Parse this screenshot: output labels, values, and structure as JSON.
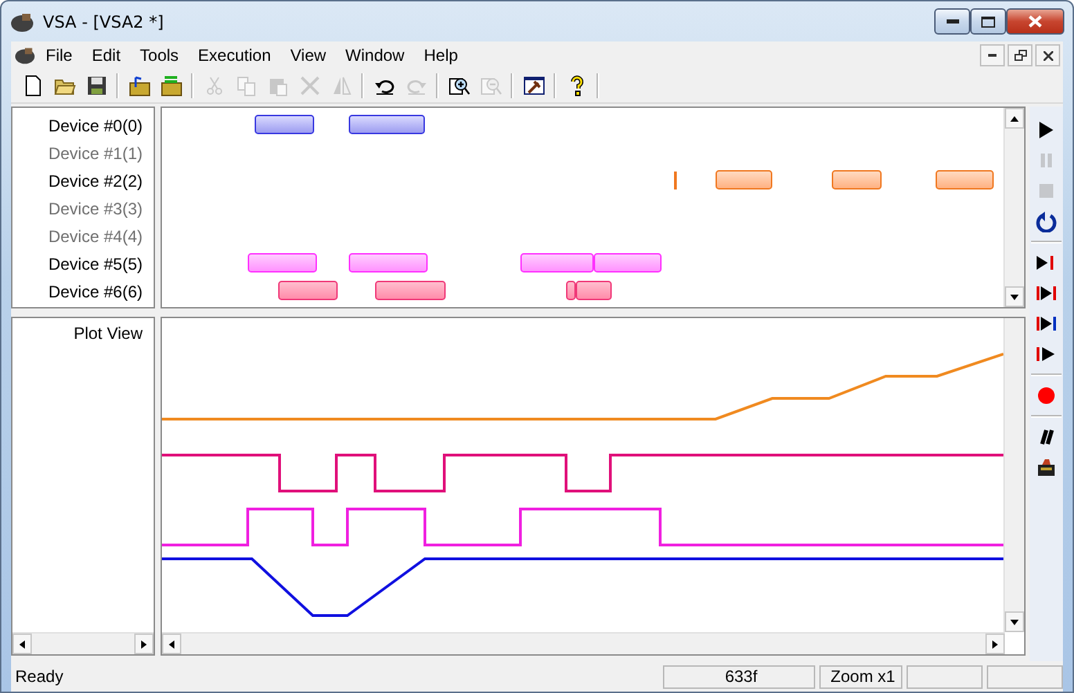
{
  "window": {
    "title": "VSA - [VSA2 *]"
  },
  "menu": [
    "File",
    "Edit",
    "Tools",
    "Execution",
    "View",
    "Window",
    "Help"
  ],
  "toolbar": [
    [
      {
        "disabled": false
      },
      {
        "disabled": false
      },
      {
        "disabled": false
      }
    ],
    [
      {
        "disabled": false
      },
      {
        "disabled": false
      }
    ],
    [
      {
        "disabled": true
      },
      {
        "disabled": true
      },
      {
        "disabled": true
      },
      {
        "disabled": true
      },
      {
        "disabled": true
      }
    ],
    [
      {
        "disabled": false
      },
      {
        "disabled": true
      }
    ],
    [
      {
        "disabled": false
      },
      {
        "disabled": true
      }
    ],
    [
      {
        "disabled": false
      }
    ],
    [
      {
        "disabled": false
      }
    ]
  ],
  "devices": [
    {
      "name": "Device #0(0)",
      "enabled": true
    },
    {
      "name": "Device #1(1)",
      "enabled": false
    },
    {
      "name": "Device #2(2)",
      "enabled": true
    },
    {
      "name": "Device #3(3)",
      "enabled": false
    },
    {
      "name": "Device #4(4)",
      "enabled": false
    },
    {
      "name": "Device #5(5)",
      "enabled": true
    },
    {
      "name": "Device #6(6)",
      "enabled": true
    }
  ],
  "plot": {
    "label": "Plot View"
  },
  "side_toolbar": [
    [
      {
        "disabled": false
      },
      {
        "disabled": true
      },
      {
        "disabled": true
      },
      {
        "disabled": false
      }
    ],
    [
      {
        "disabled": false
      },
      {
        "disabled": false
      },
      {
        "disabled": false
      },
      {
        "disabled": false
      }
    ],
    [
      {
        "disabled": false
      }
    ],
    [
      {
        "disabled": false
      },
      {
        "disabled": false
      }
    ]
  ],
  "status_bar": [
    "Ready",
    "633f",
    "Zoom x1"
  ]
}
